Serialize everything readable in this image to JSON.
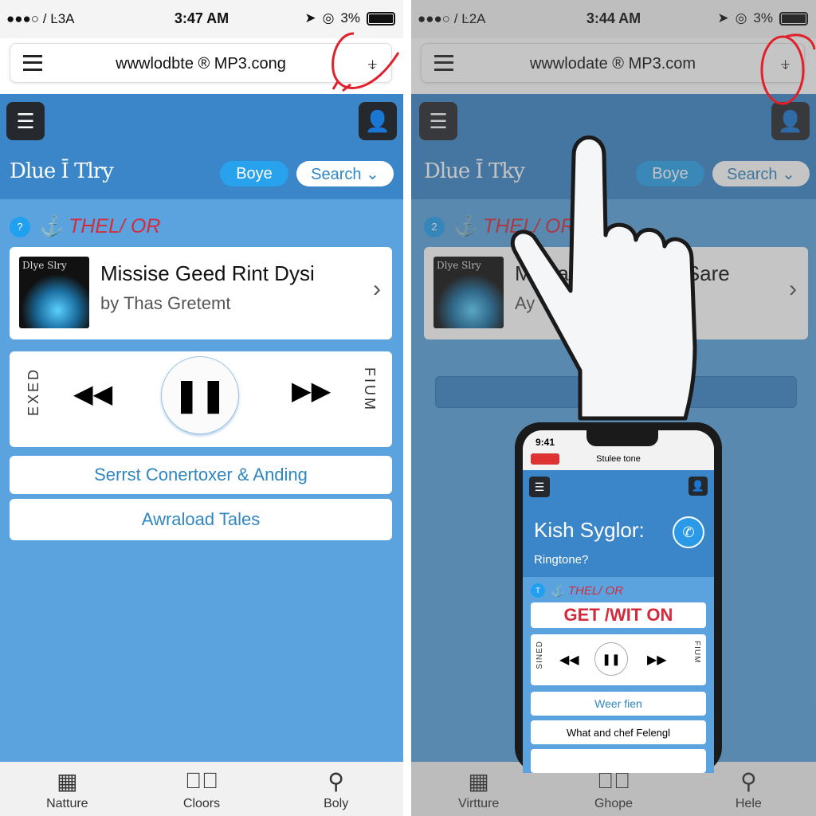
{
  "left": {
    "status": {
      "signal": "●●●○ / Ŀ3A",
      "time": "3:47 AM",
      "battery": "3%"
    },
    "url": "wwwlodbte ® MP3.cong",
    "brand": "Dlue Ī Tlry",
    "pill_label": "Boye",
    "search_label": "Search ⌄",
    "section_label": "THEL/ OR",
    "section_badge": "?",
    "track": {
      "art_text": "Dlye Slry",
      "title": "Missise Geed Rint Dysi",
      "artist": "by Thas Gretemt"
    },
    "player": {
      "left_label": "EXED",
      "right_label": "FIUM",
      "play_state": "paused"
    },
    "buttons": [
      "Serrst Conertoxer & Anding",
      "Awraload Tales"
    ],
    "tabs": [
      {
        "label": "Natture",
        "icon": "grid-book-icon"
      },
      {
        "label": "Cloors",
        "icon": "check-circle-icon"
      },
      {
        "label": "Boly",
        "icon": "search-icon"
      }
    ]
  },
  "right": {
    "status": {
      "signal": "●●●○ / Ŀ2A",
      "time": "3:44 AM",
      "battery": "3%"
    },
    "url": "wwwlodate ® MP3.com",
    "brand": "Dlue Ī Tky",
    "pill_label": "Boye",
    "search_label": "Search ⌄",
    "section_label": "THEL/ OR",
    "section_badge": "2",
    "track": {
      "art_text": "Dlye Slry",
      "title": "Miskaedleise Ylxe Sare",
      "artist": "Ay Thas Gretemt"
    },
    "button": "Doyr",
    "tabs": [
      {
        "label": "Virtture",
        "icon": "grid-book-icon"
      },
      {
        "label": "Ghope",
        "icon": "check-circle-icon"
      },
      {
        "label": "Hele",
        "icon": "search-icon"
      }
    ],
    "inner_phone": {
      "time": "9:41",
      "title": "Stulee tone",
      "heading": "Kish Syglor:",
      "subheading": "Ringtone?",
      "section_label": "THEL/ OR",
      "section_badge": "T",
      "cta": "GET /WIT ON",
      "left_label": "SINED",
      "right_label": "FIUM",
      "buttons": [
        "Weer fien",
        "What and chef Felengl"
      ]
    }
  },
  "colors": {
    "header_blue": "#3a86c8",
    "content_blue": "#5ba3de",
    "annotation_red": "#e0202a",
    "section_red": "#d42b3c"
  }
}
